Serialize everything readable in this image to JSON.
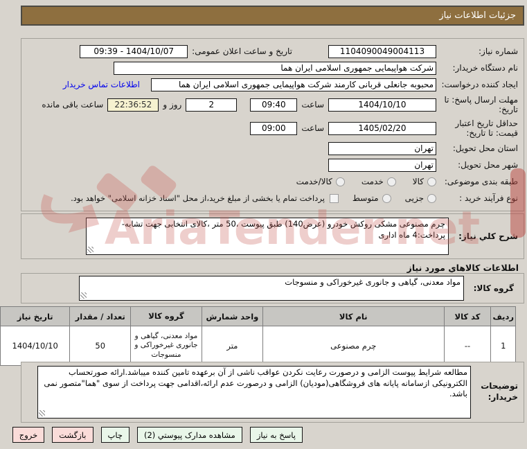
{
  "page_title": "جزئیات اطلاعات نیاز",
  "watermark_text": "AriaTender.net",
  "colors": {
    "header_bg": "#8e6f3f",
    "countdown_bg": "#f6f2d0",
    "button_green": "#e9f6e9",
    "button_pink": "#fadcd9",
    "link_blue": "#0000ee",
    "watermark_red": "#c9605a"
  },
  "form": {
    "need_number": {
      "label": "شماره نیاز:",
      "value": "1104090049004113"
    },
    "announce_datetime": {
      "label": "تاریخ و ساعت اعلان عمومی:",
      "value": "09:39 - 1404/10/07"
    },
    "buyer_org": {
      "label": "نام دستگاه خریدار:",
      "value": "شرکت هواپیمایی جمهوری اسلامی ایران هما"
    },
    "request_creator": {
      "label": "ایجاد کننده درخواست:",
      "value": "محبوبه جانعلی قربانی کارمند شرکت هواپیمایی جمهوری اسلامی ایران هما",
      "contact_link": "اطلاعات تماس خریدار"
    },
    "reply_deadline": {
      "label": "مهلت ارسال پاسخ: تا تاریخ:",
      "date": "1404/10/10",
      "hour_label": "ساعت",
      "time": "09:40"
    },
    "countdown": {
      "days": "2",
      "days_label": "روز و",
      "time": "22:36:52",
      "suffix_label": "ساعت باقی مانده"
    },
    "price_validity": {
      "label": "حداقل تاریخ اعتبار قیمت: تا تاریخ:",
      "date": "1405/02/20",
      "hour_label": "ساعت",
      "time": "09:00"
    },
    "province": {
      "label": "استان محل تحویل:",
      "value": "تهران"
    },
    "city": {
      "label": "شهر محل تحویل:",
      "value": "تهران"
    },
    "subject_class": {
      "label": "طبقه بندی موضوعی:",
      "options": [
        "کالا",
        "خدمت",
        "کالا/خدمت"
      ]
    },
    "process_type": {
      "label": "نوع فرآیند خرید :",
      "options": [
        "جزیی",
        "متوسط"
      ],
      "checkbox_label": "پرداخت تمام یا بخشی از مبلغ خرید،از محل \"اسناد خزانه اسلامی\" خواهد بود."
    }
  },
  "description": {
    "label": "شرح کلي نیاز:",
    "value": "چرم مصنوعی مشکی روکش خودرو (عرض140) طبق پیوست ،50 متر ،کالای انتخابی جهت تشابه-پرداخت:4 ماه اداری"
  },
  "goods_heading": "اطلاعات کالاهاي مورد نیاز",
  "goods_group": {
    "label": "گروه کالا:",
    "value": "مواد معدنی، گیاهی و جانوری غیرخوراکی و منسوجات"
  },
  "table": {
    "headers": [
      "ردیف",
      "کد کالا",
      "نام کالا",
      "واحد شمارش",
      "گروه کالا",
      "تعداد / مقدار",
      "تاریخ نیاز"
    ],
    "rows": [
      [
        "1",
        "--",
        "چرم مصنوعی",
        "متر",
        "مواد معدنی، گیاهی و جانوری غیرخوراکی و منسوجات",
        "50",
        "1404/10/10"
      ]
    ]
  },
  "buyer_notes": {
    "label": "توضیحات خریدار:",
    "value": "مطالعه شرایط پیوست الزامی و درصورت رعایت نکردن عواقب ناشی از آن برعهده تامین کننده میباشد.ارائه صورتحساب الکترونیکی ازسامانه پایانه های فروشگاهی(مودیان) الزامی و درصورت عدم ارائه،اقدامی جهت پرداخت از سوی \"هما\"متصور نمی باشد."
  },
  "buttons": {
    "reply": "پاسخ به نیاز",
    "attachments": "مشاهده مدارک پیوستي (2)",
    "print": "چاپ",
    "back": "بازگشت",
    "exit": "خروج"
  }
}
